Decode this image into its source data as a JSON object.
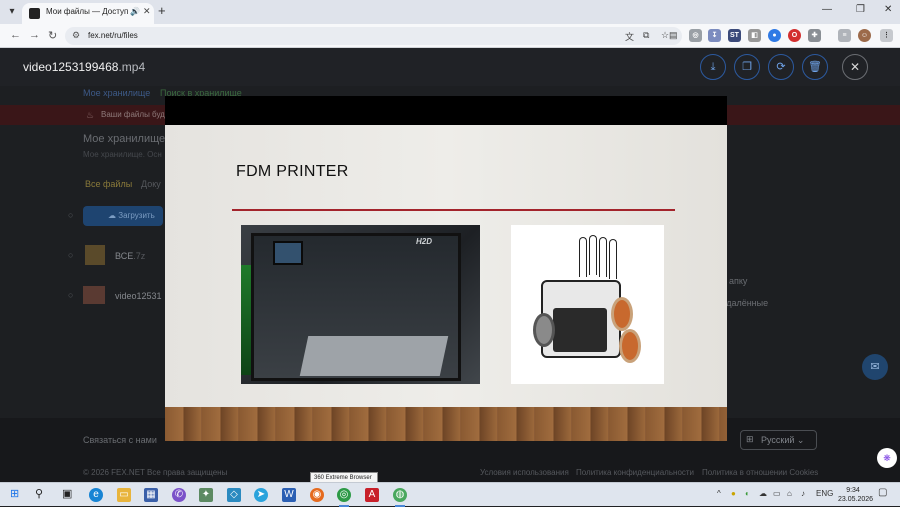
{
  "browser": {
    "tab": {
      "title": "Мои файлы — Доступ к о",
      "sound_icon": "speaker-icon"
    },
    "address": {
      "url": "fex.net/ru/files"
    },
    "window_controls": {
      "minimize": "—",
      "restore": "❐",
      "close": "✕"
    }
  },
  "background_page": {
    "breadcrumb_storage": "Мое хранилище",
    "breadcrumb_search": "Поиск в хранилище",
    "warning": "Ваши файлы буду",
    "section_title": "Мое хранилище",
    "section_subtitle": "Мое хранилище. Осн",
    "tab_all": "Все файлы",
    "tab_docs": "Доку",
    "upload_label": "Загрузить",
    "files": [
      {
        "name": "ВСЕ",
        "ext": ".7z"
      },
      {
        "name": "video12531",
        "ext": ""
      }
    ],
    "side_folder": "апку",
    "side_deleted": "удалённые",
    "contact": "Связаться с нами",
    "language": "Русский",
    "copyright": "© 2026 FEX.NET Все права защищены",
    "links": [
      "Условия использования",
      "Политика конфиденциальности",
      "Политика в отношении Cookies"
    ]
  },
  "viewer": {
    "file_base": "video1253199468",
    "file_ext": ".mp4",
    "actions": [
      "download-icon",
      "copy-icon",
      "share-icon",
      "trash-icon"
    ],
    "close_icon": "close-icon"
  },
  "slide": {
    "title": "FDM PRINTER",
    "printer_brand": "H2D",
    "accent_color": "#a3242c"
  },
  "taskbar": {
    "tooltip": "360 Extreme Browser",
    "language": "ENG",
    "time": "9:34",
    "date": "23.05.2026"
  }
}
